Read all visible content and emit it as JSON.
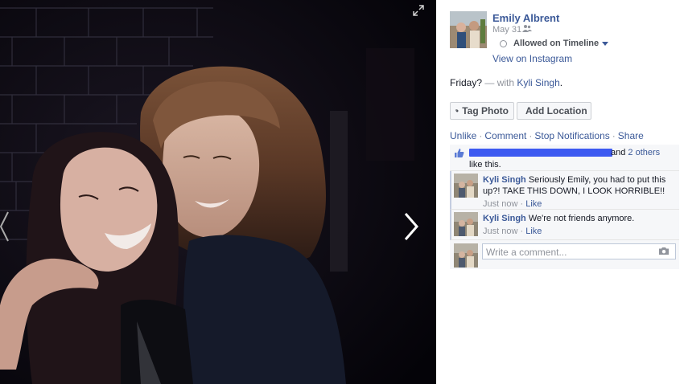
{
  "photo": {
    "icons": {
      "expand": "expand-arrow-icon",
      "next": "chevron-right-icon",
      "previous": "chevron-left-icon"
    }
  },
  "post": {
    "author": "Emily Albrent",
    "date": "May 31",
    "audience_icon": "friends-icon",
    "timeline_status": "Allowed on Timeline",
    "source_link": "View on Instagram",
    "caption": "Friday?",
    "caption_with": "— with",
    "tagged_name": "Kyli Singh",
    "caption_end": "."
  },
  "buttons": {
    "tag_photo": "Tag Photo",
    "add_location": "Add Location"
  },
  "actions": {
    "unlike": "Unlike",
    "comment": "Comment",
    "stop_notifications": "Stop Notifications",
    "share": "Share",
    "separator": "·"
  },
  "likes": {
    "connector": "and",
    "others": "2 others",
    "suffix": "like this."
  },
  "comments": [
    {
      "name": "Kyli Singh",
      "text": "Seriously Emily, you had to put this up?! TAKE THIS DOWN, I LOOK HORRIBLE!!",
      "time": "Just now",
      "like": "Like"
    },
    {
      "name": "Kyli Singh",
      "text": "We're not friends anymore.",
      "time": "Just now",
      "like": "Like"
    }
  ],
  "composer": {
    "placeholder": "Write a comment...",
    "icon": "camera-icon"
  },
  "colors": {
    "link": "#3b5998",
    "muted": "#90949c",
    "redaction": "#3d5af1",
    "stage": "#05040a"
  }
}
